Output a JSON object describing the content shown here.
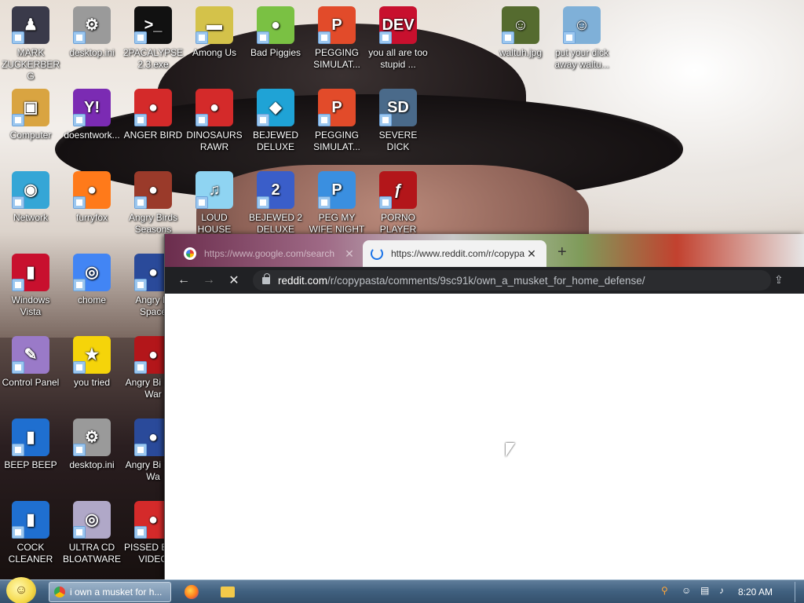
{
  "desktop_icons": [
    {
      "label": "MARK ZUCKERBERG",
      "glyph": "♟",
      "color": "#3a3a4a",
      "icon": "person-icon"
    },
    {
      "label": "desktop.ini",
      "glyph": "⚙",
      "color": "#9a9a9a",
      "icon": "settings-file-icon"
    },
    {
      "label": "2PACALYPSE 2.3.exe",
      "glyph": ">_",
      "color": "#111111",
      "icon": "terminal-icon"
    },
    {
      "label": "Among Us",
      "glyph": "▬",
      "color": "#d4c24a",
      "icon": "game-icon"
    },
    {
      "label": "Bad Piggies",
      "glyph": "●",
      "color": "#7ac143",
      "icon": "pig-icon"
    },
    {
      "label": "PEGGING SIMULAT...",
      "glyph": "P",
      "color": "#e24b2a",
      "icon": "p-logo-icon"
    },
    {
      "label": "you all are too stupid ...",
      "glyph": "DEV",
      "color": "#c8102e",
      "icon": "devcpp-icon"
    },
    {
      "label": "waltuh.jpg",
      "glyph": "☺",
      "color": "#556b2f",
      "icon": "photo-icon"
    },
    {
      "label": "put your dick away waltu...",
      "glyph": "☺",
      "color": "#7fb0d8",
      "icon": "photo-icon"
    },
    {
      "label": "Computer",
      "glyph": "▣",
      "color": "#d9a441",
      "icon": "computer-icon"
    },
    {
      "label": "doesntwork...",
      "glyph": "Y!",
      "color": "#7b2bb3",
      "icon": "yahoo-icon"
    },
    {
      "label": "ANGER BIRD",
      "glyph": "●",
      "color": "#d42a2a",
      "icon": "angry-bird-icon"
    },
    {
      "label": "DINOSAURS RAWR",
      "glyph": "●",
      "color": "#d42a2a",
      "icon": "angry-bird-icon"
    },
    {
      "label": "BEJEWED DELUXE",
      "glyph": "◆",
      "color": "#1fa3d6",
      "icon": "gem-icon"
    },
    {
      "label": "PEGGING SIMULAT...",
      "glyph": "P",
      "color": "#e24b2a",
      "icon": "p-logo-icon"
    },
    {
      "label": "SEVERE DICK",
      "glyph": "SD",
      "color": "#4a6a8a",
      "icon": "gear-icon"
    },
    {
      "label": "Network",
      "glyph": "◉",
      "color": "#35a6d6",
      "icon": "network-icon"
    },
    {
      "label": "furryfox",
      "glyph": "●",
      "color": "#ff7a1a",
      "icon": "firefox-icon"
    },
    {
      "label": "Angry Birds Seasons",
      "glyph": "●",
      "color": "#9a3a2a",
      "icon": "angry-bird-icon"
    },
    {
      "label": "LOUD HOUSE",
      "glyph": "♫",
      "color": "#8fd4f2",
      "icon": "bird-icon"
    },
    {
      "label": "BEJEWED 2 DELUXE",
      "glyph": "2",
      "color": "#3a5ec9",
      "icon": "gem-icon"
    },
    {
      "label": "PEG MY WIFE NIGHT",
      "glyph": "P",
      "color": "#3a8fe0",
      "icon": "p-logo-icon"
    },
    {
      "label": "PORNO PLAYER",
      "glyph": "ƒ",
      "color": "#b3161a",
      "icon": "flash-icon"
    },
    {
      "label": "Windows Vista",
      "glyph": "▮",
      "color": "#c8102e",
      "icon": "recycle-bin-icon"
    },
    {
      "label": "chome",
      "glyph": "◎",
      "color": "#4285f4",
      "icon": "chrome-icon"
    },
    {
      "label": "Angry Bi Space",
      "glyph": "●",
      "color": "#2a4a9a",
      "icon": "angry-bird-icon"
    },
    {
      "label": "Control Panel",
      "glyph": "✎",
      "color": "#9a7ac8",
      "icon": "control-panel-icon"
    },
    {
      "label": "you tried",
      "glyph": "★",
      "color": "#f5d40a",
      "icon": "star-icon"
    },
    {
      "label": "Angry Bi Star War",
      "glyph": "●",
      "color": "#b3161a",
      "icon": "angry-bird-icon"
    },
    {
      "label": "BEEP BEEP",
      "glyph": "▮",
      "color": "#1f6fd0",
      "icon": "app-icon"
    },
    {
      "label": "desktop.ini",
      "glyph": "⚙",
      "color": "#9a9a9a",
      "icon": "settings-file-icon"
    },
    {
      "label": "Angry Bi Star Wa",
      "glyph": "●",
      "color": "#2a4a9a",
      "icon": "angry-bird-icon"
    },
    {
      "label": "COCK CLEANER",
      "glyph": "▮",
      "color": "#1f6fd0",
      "icon": "app-icon"
    },
    {
      "label": "ULTRA CD BLOATWARE",
      "glyph": "◎",
      "color": "#b0a8c8",
      "icon": "cd-icon"
    },
    {
      "label": "PISSED BI IN VIDEO",
      "glyph": "●",
      "color": "#d42a2a",
      "icon": "angry-bird-icon"
    }
  ],
  "browser": {
    "tabs": [
      {
        "title": "https://www.google.com/search",
        "state": "inactive"
      },
      {
        "title": "https://www.reddit.com/r/copypa",
        "state": "active"
      }
    ],
    "new_tab_label": "+",
    "url_domain": "reddit.com",
    "url_path": "/r/copypasta/comments/9sc91k/own_a_musket_for_home_defense/"
  },
  "taskbar": {
    "browser_task_label": "i own a musket for h...",
    "clock": "8:20 AM"
  }
}
